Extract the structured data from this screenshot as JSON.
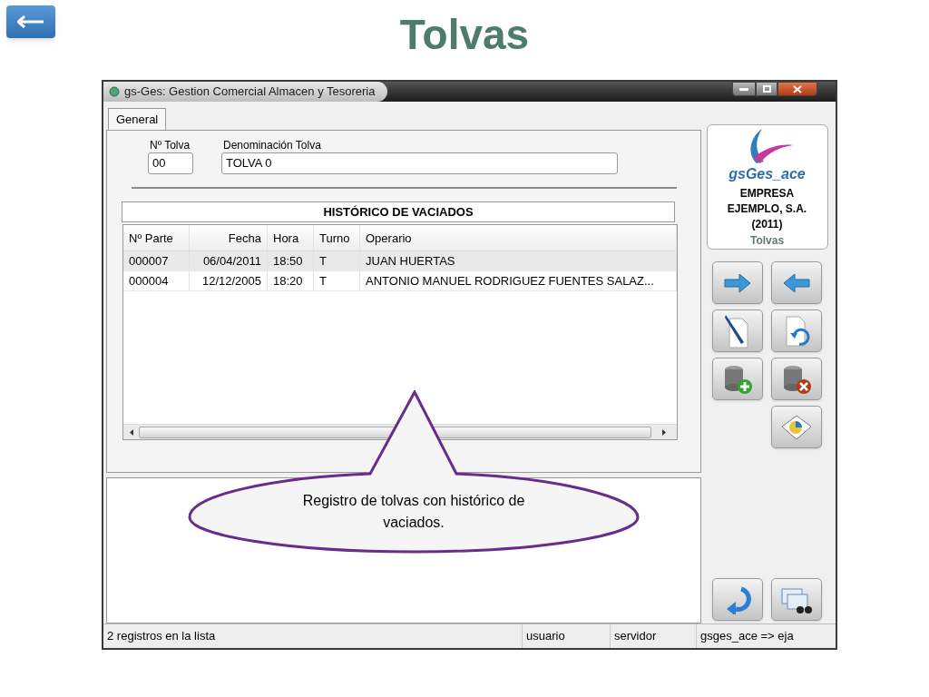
{
  "slide": {
    "title": "Tolvas"
  },
  "window": {
    "title": "gs-Ges: Gestion Comercial Almacen y Tesoreria"
  },
  "tabs": [
    {
      "label": "General",
      "selected": true
    }
  ],
  "fields": [
    {
      "label": "Nº Tolva",
      "value": "00"
    },
    {
      "label": "Denominación Tolva",
      "value": "TOLVA 0"
    }
  ],
  "table": {
    "title": "HISTÓRICO DE VACIADOS",
    "columns": [
      "Nº Parte",
      "Fecha",
      "Hora",
      "Turno",
      "Operario"
    ],
    "rows": [
      {
        "selected": true,
        "cells": [
          "000007",
          "06/04/2011",
          "18:50",
          "T",
          "JUAN HUERTAS"
        ]
      },
      {
        "selected": false,
        "cells": [
          "000004",
          "12/12/2005",
          "18:20",
          "T",
          "ANTONIO MANUEL RODRIGUEZ FUENTES SALAZ..."
        ]
      }
    ]
  },
  "brand": {
    "logo_text": "gsGes_ace",
    "company": "EMPRESA EJEMPLO, S.A. (2011)",
    "module": "Tolvas"
  },
  "callout": {
    "text": "Registro de tolvas con histórico de vaciados."
  },
  "status_bar": [
    "2 registros en la lista",
    "usuario",
    "servidor",
    "gsges_ace => eja"
  ]
}
